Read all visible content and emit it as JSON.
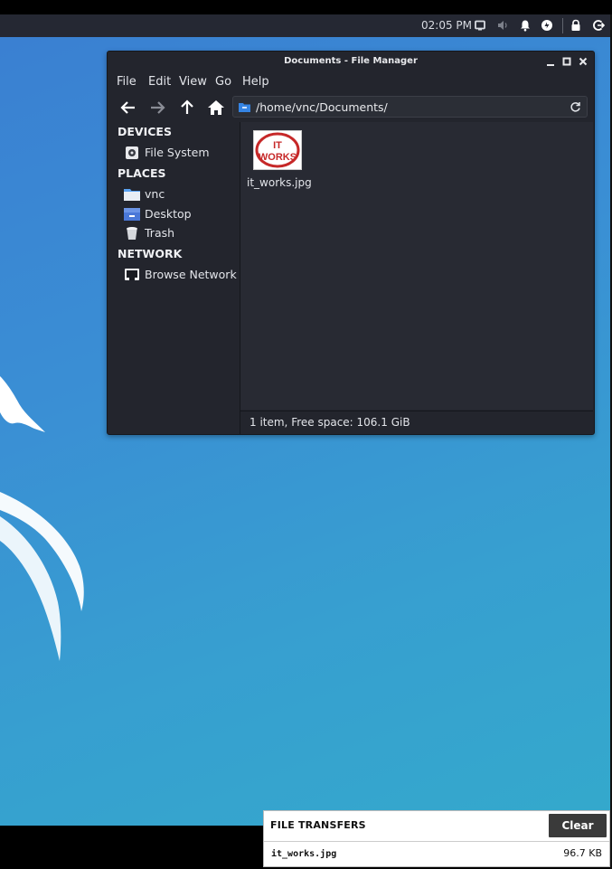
{
  "topbar": {
    "clock": "02:05 PM",
    "icons": [
      "display-icon",
      "volume-muted-icon",
      "bell-icon",
      "power-manager-icon",
      "lock-icon",
      "logout-icon"
    ]
  },
  "window": {
    "title": "Documents - File Manager",
    "menus": [
      "File",
      "Edit",
      "View",
      "Go",
      "Help"
    ],
    "location": "/home/vnc/Documents/",
    "sidebar": {
      "devices_label": "DEVICES",
      "devices": [
        {
          "label": "File System",
          "icon": "drive-icon"
        }
      ],
      "places_label": "PLACES",
      "places": [
        {
          "label": "vnc",
          "icon": "home-folder-icon"
        },
        {
          "label": "Desktop",
          "icon": "desktop-folder-icon"
        },
        {
          "label": "Trash",
          "icon": "trash-icon"
        }
      ],
      "network_label": "NETWORK",
      "network": [
        {
          "label": "Browse Network",
          "icon": "network-icon"
        }
      ]
    },
    "files": [
      {
        "name": "it_works.jpg",
        "thumb_text": [
          "IT",
          "WORKS"
        ]
      }
    ],
    "status": "1 item, Free space: 106.1 GiB"
  },
  "file_transfers": {
    "title": "FILE TRANSFERS",
    "clear_label": "Clear",
    "items": [
      {
        "name": "it_works.jpg",
        "size": "96.7 KB"
      }
    ]
  },
  "colors": {
    "desktop_gradient_start": "#3a7fd2",
    "desktop_gradient_end": "#34a9cc",
    "window_bg": "#23252d",
    "accent_blue": "#3584e4",
    "thumb_red": "#c62828"
  }
}
